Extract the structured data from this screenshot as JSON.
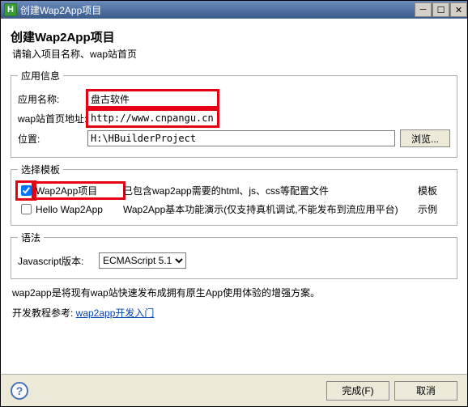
{
  "titlebar": {
    "icon_letter": "H",
    "title": "创建Wap2App项目"
  },
  "header": {
    "title": "创建Wap2App项目",
    "subtitle": "请输入项目名称、wap站首页"
  },
  "app_info": {
    "legend": "应用信息",
    "name_label": "应用名称:",
    "name_value": "盘古软件",
    "url_label": "wap站首页地址:",
    "url_value": "http://www.cnpangu.cn",
    "loc_label": "位置:",
    "loc_value": "H:\\HBuilderProject",
    "browse_label": "浏览..."
  },
  "tpl": {
    "legend": "选择模板",
    "col_cat": "模板",
    "rows": [
      {
        "checked": true,
        "name": "Wap2App项目",
        "desc": "已包含wap2app需要的html、js、css等配置文件",
        "cat": "模板"
      },
      {
        "checked": false,
        "name": "Hello Wap2App",
        "desc": "Wap2App基本功能演示(仅支持真机调试,不能发布到流应用平台)",
        "cat": "示例"
      }
    ]
  },
  "grammar": {
    "legend": "语法",
    "label": "Javascript版本:",
    "value": "ECMAScript 5.1"
  },
  "note": {
    "line1": "wap2app是将现有wap站快速发布成拥有原生App使用体验的增强方案。",
    "line2_prefix": "开发教程参考: ",
    "link_text": "wap2app开发入门"
  },
  "footer": {
    "finish": "完成(F)",
    "cancel": "取消"
  }
}
